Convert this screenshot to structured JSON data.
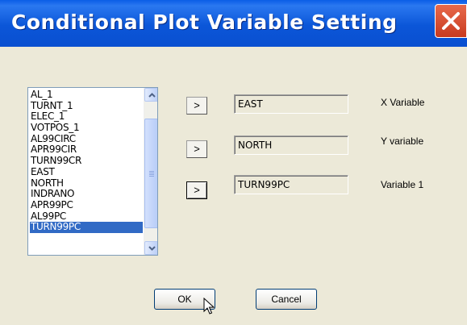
{
  "window": {
    "title": "Conditional Plot Variable Setting"
  },
  "variable_list": {
    "items": [
      "AL_1",
      "TURNT_1",
      "ELEC_1",
      "VOTPOS_1",
      "AL99CIRC",
      "APR99CIR",
      "TURN99CR",
      "EAST",
      "NORTH",
      "INDRANO",
      "APR99PC",
      "AL99PC",
      "TURN99PC"
    ],
    "selected": "TURN99PC"
  },
  "assignments": [
    {
      "button_label": ">",
      "value": "EAST",
      "label": "X Variable"
    },
    {
      "button_label": ">",
      "value": "NORTH",
      "label": "Y variable"
    },
    {
      "button_label": ">",
      "value": "TURN99PC",
      "label": "Variable 1"
    }
  ],
  "buttons": {
    "ok": "OK",
    "cancel": "Cancel"
  },
  "icons": {
    "close": "close-x-icon",
    "scroll_up": "scroll-up-arrow-icon",
    "scroll_down": "scroll-down-arrow-icon",
    "cursor": "mouse-pointer-icon"
  },
  "colors": {
    "titlebar": "#0b56d8",
    "close_button": "#d9502f",
    "selection": "#316ac5",
    "dialog_bg": "#ece9d8"
  }
}
